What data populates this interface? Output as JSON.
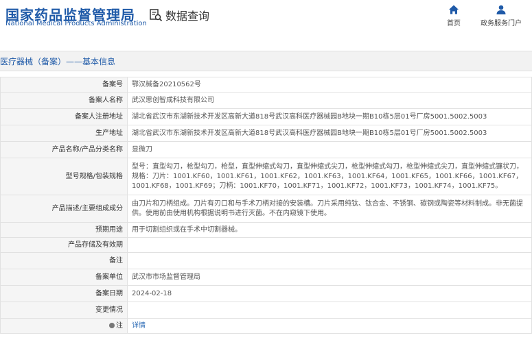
{
  "header": {
    "logo_cn": "国家药品监督管理局",
    "logo_en": "National Medical Products Administration",
    "query_label": "数据查询",
    "nav": [
      {
        "label": "首页",
        "icon": "home-icon"
      },
      {
        "label": "政务服务门户",
        "icon": "user-icon"
      }
    ]
  },
  "section_title": "医疗器械（备案）——基本信息",
  "colors": {
    "brand": "#1f5aa8",
    "link": "#2a6ab5"
  },
  "rows": [
    {
      "k": "备案号",
      "v": "鄂汉械备20210562号"
    },
    {
      "k": "备案人名称",
      "v": "武汉思创智成科技有限公司"
    },
    {
      "k": "备案人注册地址",
      "v": "湖北省武汉市东湖新技术开发区高新大道818号武汉高科医疗器械园B地块一期B10栋5层01号厂房5001.5002.5003"
    },
    {
      "k": "生产地址",
      "v": "湖北省武汉市东湖新技术开发区高新大道818号武汉高科医疗器械园B地块一期B10栋5层01号厂房5001.5002.5003"
    },
    {
      "k": "产品名称/产品分类名称",
      "v": "显微刀"
    },
    {
      "k": "型号规格/包装规格",
      "v": "型号：直型勾刀，枪型勾刀，枪型，直型伸缩式勾刀，直型伸缩式尖刀，枪型伸缩式勾刀，枪型伸缩式尖刀，直型伸缩式镰状刀，规格：刀片：1001.KF60，1001.KF61，1001.KF62，1001.KF63，1001.KF64，1001.KF65，1001.KF66，1001.KF67，1001.KF68，1001.KF69；刀柄：1001.KF70，1001.KF71，1001.KF72，1001.KF73，1001.KF74，1001.KF75。"
    },
    {
      "k": "产品描述/主要组成成分",
      "v": "由刀片和刀柄组成。刀片有刃口和与手术刀柄对接的安装槽。刀片采用纯钛、钛合金、不锈钢、碳钢或陶瓷等材料制成。非无菌提供。使用前由使用机构根据说明书进行灭菌。不在内窥镜下使用。"
    },
    {
      "k": "预期用途",
      "v": "用于切割组织或在手术中切割器械。"
    },
    {
      "k": "产品存储及有效期",
      "v": ""
    },
    {
      "k": "备注",
      "v": ""
    },
    {
      "k": "备案单位",
      "v": "武汉市市场监督管理局"
    },
    {
      "k": "备案日期",
      "v": "2024-02-18"
    },
    {
      "k": "变更情况",
      "v": ""
    },
    {
      "k": "注",
      "v": "详情"
    }
  ]
}
